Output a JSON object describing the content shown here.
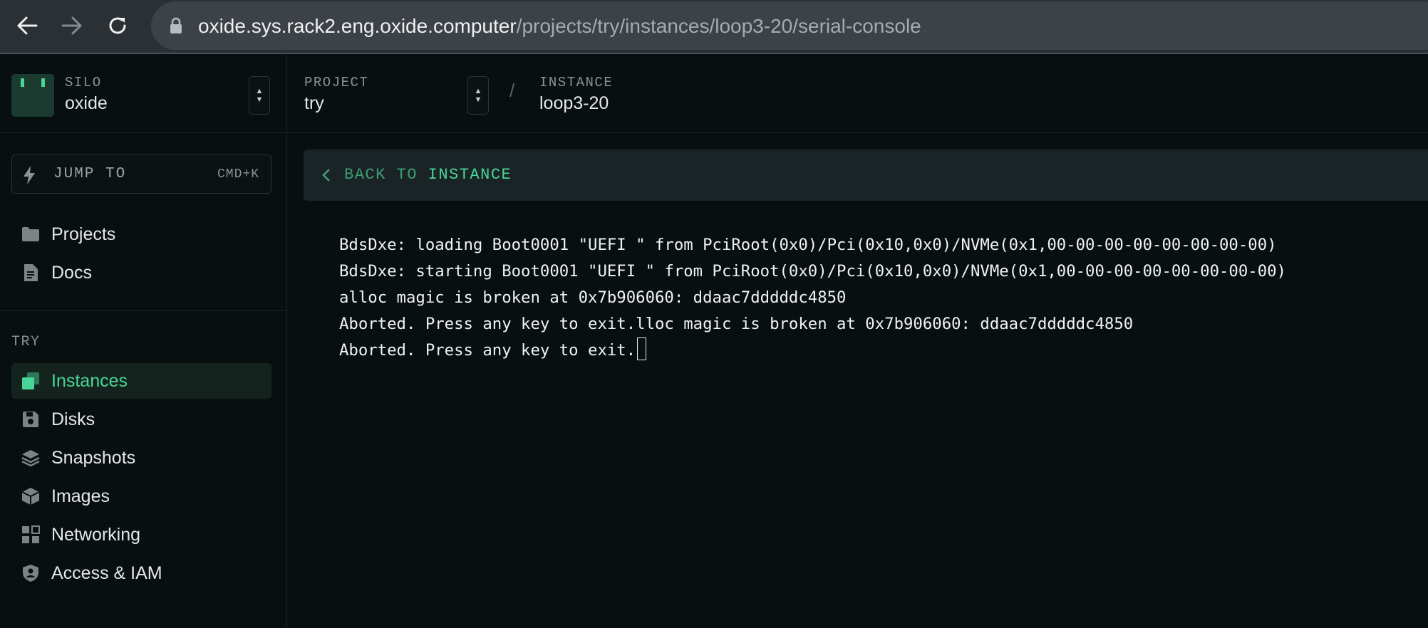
{
  "browser": {
    "url_host": "oxide.sys.rack2.eng.oxide.computer",
    "url_path": "/projects/try/instances/loop3-20/serial-console",
    "icons": [
      "back-arrow-icon",
      "forward-arrow-icon",
      "reload-icon",
      "lock-icon"
    ]
  },
  "silo": {
    "eyebrow": "SILO",
    "name": "oxide"
  },
  "breadcrumbs": {
    "project_eyebrow": "PROJECT",
    "project_name": "try",
    "separator": "/",
    "instance_eyebrow": "INSTANCE",
    "instance_name": "loop3-20"
  },
  "jump": {
    "label": "JUMP TO",
    "shortcut": "CMD+K"
  },
  "sidebar": {
    "global_items": [
      {
        "label": "Projects",
        "icon": "folder-icon"
      },
      {
        "label": "Docs",
        "icon": "document-icon"
      }
    ],
    "section_label": "TRY",
    "project_items": [
      {
        "label": "Instances",
        "icon": "instances-icon",
        "active": true
      },
      {
        "label": "Disks",
        "icon": "disk-icon"
      },
      {
        "label": "Snapshots",
        "icon": "snapshots-icon"
      },
      {
        "label": "Images",
        "icon": "image-icon"
      },
      {
        "label": "Networking",
        "icon": "networking-icon"
      },
      {
        "label": "Access & IAM",
        "icon": "access-icon"
      }
    ]
  },
  "back_link": {
    "prefix": "BACK TO ",
    "target": "INSTANCE"
  },
  "console": {
    "lines": [
      "BdsDxe: loading Boot0001 \"UEFI \" from PciRoot(0x0)/Pci(0x10,0x0)/NVMe(0x1,00-00-00-00-00-00-00-00)",
      "BdsDxe: starting Boot0001 \"UEFI \" from PciRoot(0x0)/Pci(0x10,0x0)/NVMe(0x1,00-00-00-00-00-00-00-00)",
      "alloc magic is broken at 0x7b906060: ddaac7dddddc4850",
      "Aborted. Press any key to exit.lloc magic is broken at 0x7b906060: ddaac7dddddc4850",
      "Aborted. Press any key to exit."
    ]
  },
  "colors": {
    "background": "#080f11",
    "accent": "#48d597",
    "accent_dim": "#3f9d74",
    "browser_chrome": "#2b3034"
  }
}
